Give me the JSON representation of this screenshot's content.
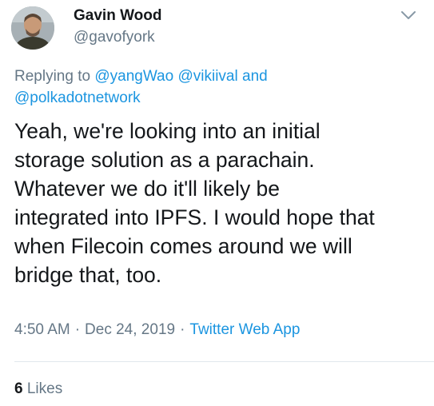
{
  "author": {
    "name": "Gavin Wood",
    "handle": "@gavofyork"
  },
  "reply": {
    "prefix": "Replying to",
    "mention_1": "@yangWao",
    "mention_2": "@vikiival",
    "conjunction": "and",
    "mention_3": "@polkadotnetwork"
  },
  "tweet": {
    "text": "Yeah, we're looking into an initial\nstorage solution as a parachain.\nWhatever we do it'll likely be\nintegrated into IPFS. I would hope that\nwhen Filecoin comes around we will\nbridge that, too."
  },
  "meta": {
    "time": "4:50 AM",
    "separator": "·",
    "date": "Dec 24, 2019",
    "source": "Twitter Web App"
  },
  "stats": {
    "likes_count": "6",
    "likes_label": "Likes"
  },
  "icons": {
    "menu": "chevron-down-icon"
  },
  "colors": {
    "link": "#1b95e0",
    "secondary_text": "#657786",
    "primary_text": "#14171a",
    "divider": "#e1e8ed"
  }
}
